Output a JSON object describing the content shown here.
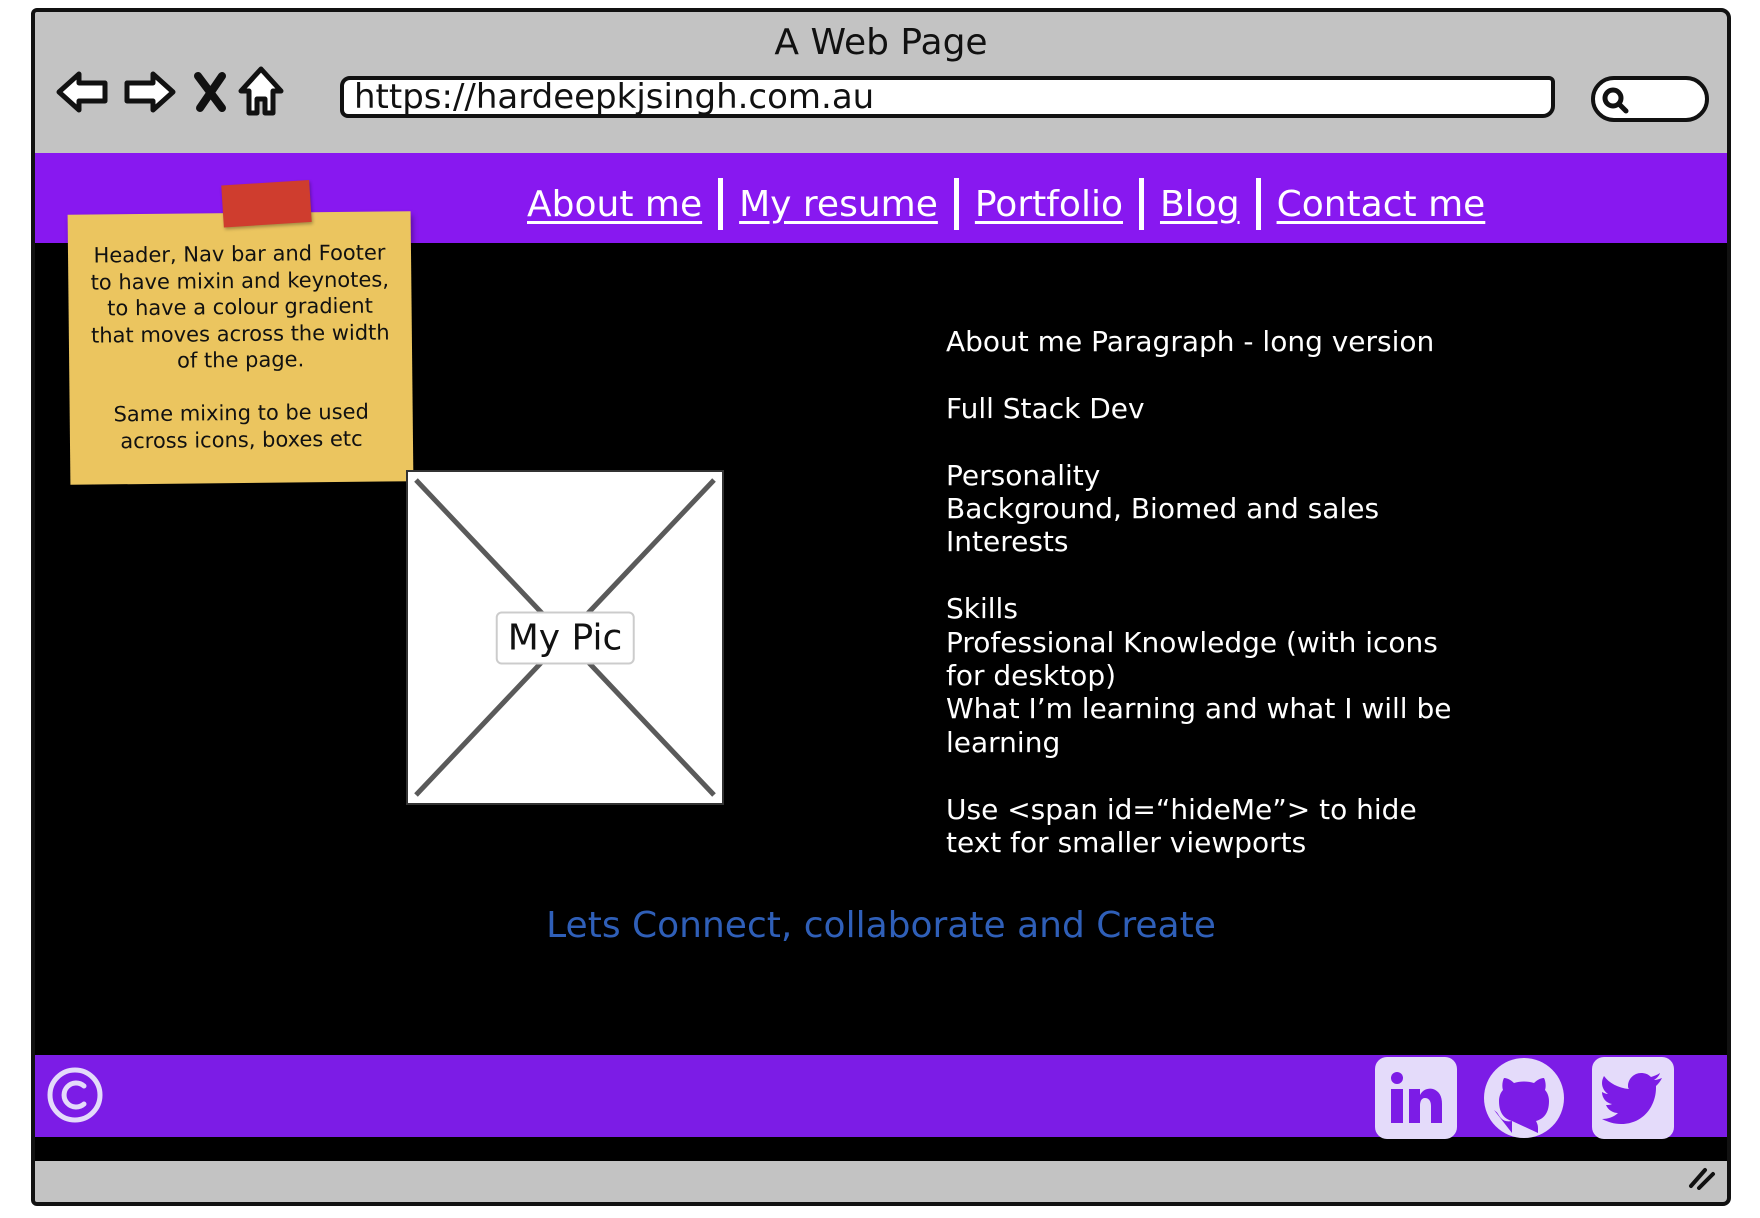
{
  "window": {
    "title": "A Web Page"
  },
  "address_bar": {
    "url": "https://hardeepkjsingh.com.au"
  },
  "nav": {
    "links": [
      "About me",
      "My resume",
      "Portfolio",
      "Blog",
      "Contact me"
    ]
  },
  "sticky_note": {
    "lines": [
      "Header, Nav bar and Footer",
      "to have mixin and keynotes,",
      "to have a colour gradient",
      "that moves across the width",
      "of the page."
    ],
    "lines2": [
      "Same mixing to be used",
      "across icons, boxes etc"
    ]
  },
  "picture": {
    "label": "My Pic"
  },
  "about": {
    "p1": "About me Paragraph - long version",
    "p2": "Full Stack Dev",
    "p3a": "Personality",
    "p3b": "Background, Biomed and sales",
    "p3c": "Interests",
    "p4a": "Skills",
    "p4b": "Professional Knowledge (with icons for desktop)",
    "p4c": "What I’m learning and what I will be learning",
    "p5": "Use <span id=“hideMe”> to hide text for smaller viewports"
  },
  "connect": {
    "text": "Lets Connect, collaborate and Create"
  },
  "footer": {
    "social": [
      "linkedin-icon",
      "github-icon",
      "twitter-icon"
    ]
  },
  "colors": {
    "header": "#8818f0",
    "footer": "#7c1ce6",
    "page_bg": "#000000",
    "connect_text": "#2f5fb8",
    "sticky": "#ebc55f",
    "icon_tile": "#e4dbfa"
  }
}
